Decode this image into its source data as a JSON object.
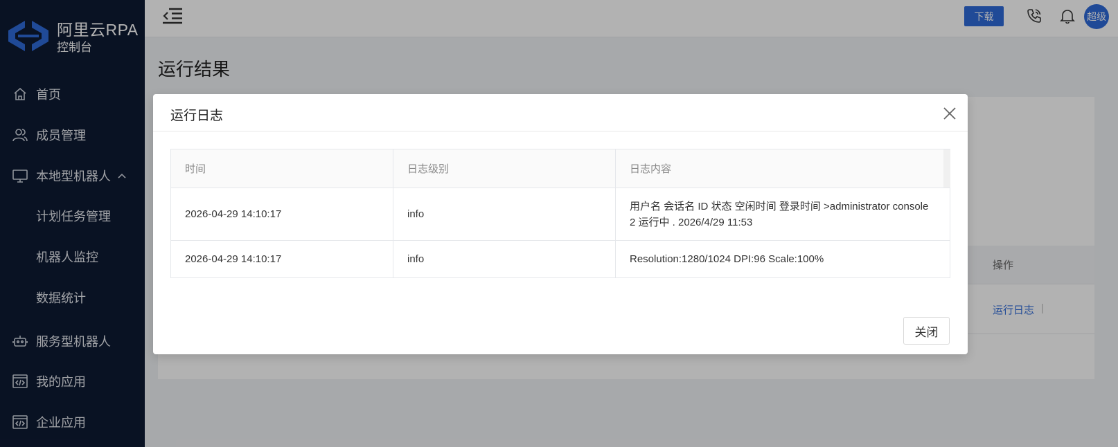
{
  "sidebar": {
    "brand": "阿里云RPA",
    "subtitle": "控制台",
    "items": [
      {
        "label": "首页",
        "icon": "home-icon"
      },
      {
        "label": "成员管理",
        "icon": "user-icon"
      },
      {
        "label": "本地型机器人",
        "icon": "monitor-icon",
        "expanded": true
      },
      {
        "label": "计划任务管理"
      },
      {
        "label": "机器人监控"
      },
      {
        "label": "数据统计"
      },
      {
        "label": "服务型机器人",
        "icon": "robot-icon"
      },
      {
        "label": "我的应用",
        "icon": "code-window-icon"
      },
      {
        "label": "企业应用",
        "icon": "code-window-icon"
      }
    ]
  },
  "header": {
    "download_label": "下载",
    "avatar_text": "超级"
  },
  "page": {
    "title": "运行结果",
    "bg_table_op_header": "操作",
    "bg_link": "运行日志",
    "bg_sep": "|"
  },
  "modal": {
    "title": "运行日志",
    "columns": [
      "时间",
      "日志级别",
      "日志内容"
    ],
    "rows": [
      {
        "time": "2026-04-29 14:10:17",
        "level": "info",
        "content": "用户名 会话名 ID 状态 空闲时间 登录时间 >administrator console 2 运行中 . 2026/4/29 11:53"
      },
      {
        "time": "2026-04-29 14:10:17",
        "level": "info",
        "content": "Resolution:1280/1024 DPI:96 Scale:100%"
      }
    ],
    "close_label": "关闭"
  },
  "colors": {
    "sidebar_bg": "#0e1a33",
    "accent": "#2f6ad9"
  }
}
